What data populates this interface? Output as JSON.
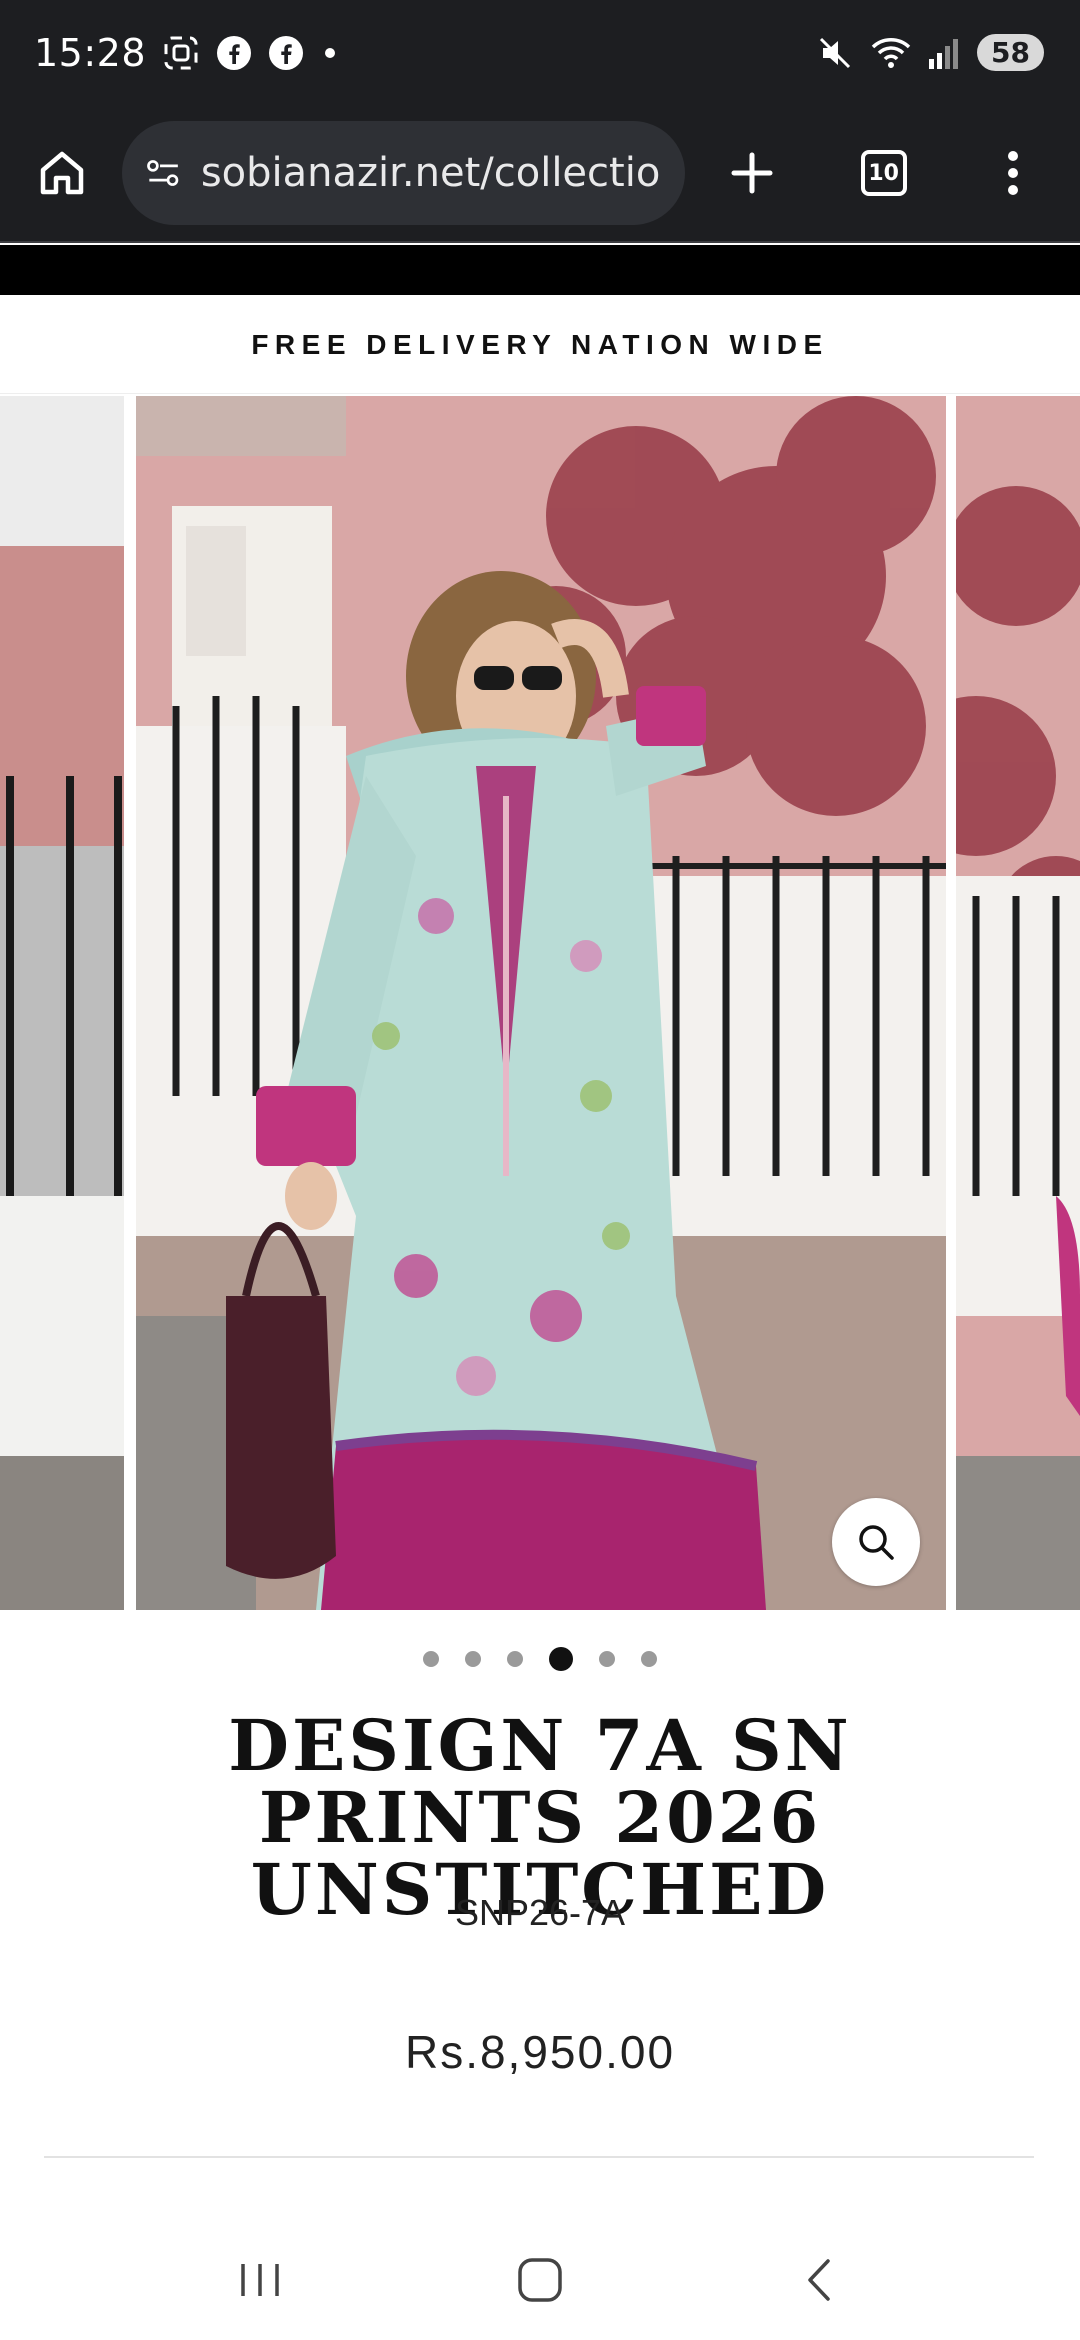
{
  "status_bar": {
    "time": "15:28",
    "battery": "58",
    "left_icons": [
      "screenshot-icon",
      "facebook-icon",
      "facebook-icon",
      "notification-dot-icon"
    ],
    "right_icons": [
      "mute-icon",
      "wifi-icon",
      "signal-icon"
    ]
  },
  "browser": {
    "url": "sobianazir.net/collections/",
    "tabs_count": "10",
    "icons": [
      "home-icon",
      "site-settings-icon",
      "new-tab-icon",
      "tab-switcher-icon",
      "more-menu-icon"
    ]
  },
  "announcement": "FREE DELIVERY NATION WIDE",
  "gallery": {
    "total_slides": 6,
    "active_slide": 4,
    "zoom_icon": "search-icon"
  },
  "product": {
    "title": "DESIGN 7A SN PRINTS 2026 UNSTITCHED",
    "sku": "SNP26-7A",
    "price": "Rs.8,950.00"
  },
  "nav_bar": {
    "icons": [
      "recent-apps-icon",
      "home-nav-icon",
      "back-icon"
    ]
  },
  "colors": {
    "chrome_dark": "#1d1e21",
    "url_pill": "#2e3035",
    "accent_magenta": "#a8246e",
    "dress_mint": "#b9dcd6",
    "wall_pink": "#d9a7a6"
  }
}
